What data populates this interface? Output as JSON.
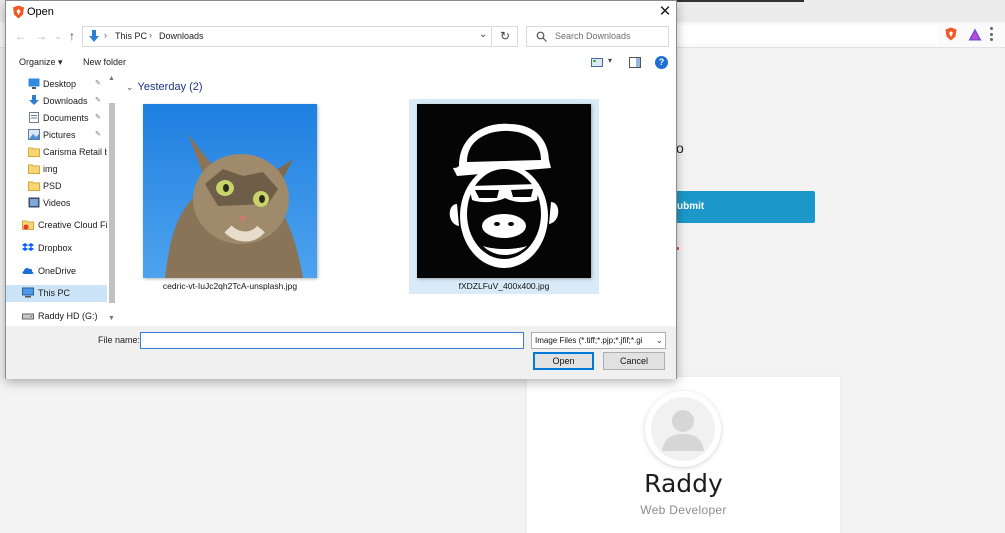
{
  "dialog": {
    "title": "Open",
    "close_glyph": "✕",
    "nav": {
      "back_glyph": "←",
      "forward_glyph": "→",
      "recent_glyph": "⌄",
      "up_glyph": "↑",
      "breadcrumb": [
        "This PC",
        "Downloads"
      ],
      "breadcrumb_sep": "›",
      "dropdown_glyph": "⌄",
      "refresh_glyph": "↻",
      "search_placeholder": "Search Downloads"
    },
    "commands": {
      "organize": "Organize ▾",
      "new_folder": "New folder",
      "view_dropdown": "▾",
      "help": "?"
    },
    "sidebar": [
      {
        "label": "Desktop",
        "icon": "desktop-icon",
        "pinned": true
      },
      {
        "label": "Downloads",
        "icon": "downloads-icon",
        "pinned": true
      },
      {
        "label": "Documents",
        "icon": "documents-icon",
        "pinned": true
      },
      {
        "label": "Pictures",
        "icon": "pictures-icon",
        "pinned": true
      },
      {
        "label": "Carisma Retail b",
        "icon": "folder-icon",
        "pinned": false
      },
      {
        "label": "img",
        "icon": "folder-icon",
        "pinned": false
      },
      {
        "label": "PSD",
        "icon": "folder-icon",
        "pinned": false
      },
      {
        "label": "Videos",
        "icon": "videos-icon",
        "pinned": false
      },
      {
        "label": "Creative Cloud Fil",
        "icon": "creative-cloud-icon",
        "pinned": false
      },
      {
        "label": "Dropbox",
        "icon": "dropbox-icon",
        "pinned": false
      },
      {
        "label": "OneDrive",
        "icon": "onedrive-icon",
        "pinned": false
      },
      {
        "label": "This PC",
        "icon": "this-pc-icon",
        "pinned": false,
        "selected": true
      },
      {
        "label": "Raddy HD (G:)",
        "icon": "drive-icon",
        "pinned": false
      }
    ],
    "pin_glyph": "📌",
    "files": {
      "group_label": "Yesterday (2)",
      "items": [
        {
          "name": "cedric-vt-IuJc2qh2TcA-unsplash.jpg",
          "selected": false
        },
        {
          "name": "fXDZLFuV_400x400.jpg",
          "selected": true
        }
      ]
    },
    "bottom": {
      "file_name_label": "File name:",
      "file_name_value": "",
      "file_type": "Image Files (*.tiff;*.pjp;*.jfif;*.gi",
      "open_label": "Open",
      "cancel_label": "Cancel"
    }
  },
  "page": {
    "submit_fragment": "ubmit",
    "heading_fragment": "o",
    "profile": {
      "name": "Raddy",
      "role": "Web Developer"
    }
  },
  "colors": {
    "accent": "#0078d7",
    "submit_bg": "#1b98c9",
    "selection": "#cce4f7"
  }
}
